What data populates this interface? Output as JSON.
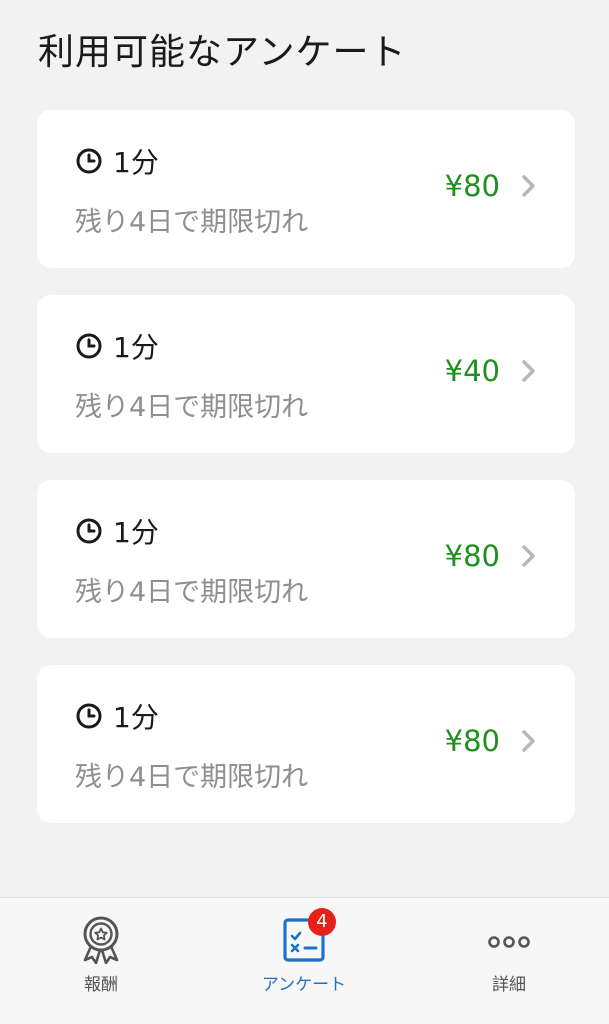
{
  "page": {
    "title": "利用可能なアンケート"
  },
  "surveys": [
    {
      "duration": "1分",
      "expiry": "残り4日で期限切れ",
      "reward": "¥80"
    },
    {
      "duration": "1分",
      "expiry": "残り4日で期限切れ",
      "reward": "¥40"
    },
    {
      "duration": "1分",
      "expiry": "残り4日で期限切れ",
      "reward": "¥80"
    },
    {
      "duration": "1分",
      "expiry": "残り4日で期限切れ",
      "reward": "¥80"
    }
  ],
  "tabbar": {
    "tabs": [
      {
        "label": "報酬",
        "icon": "award-medal-icon",
        "active": false
      },
      {
        "label": "アンケート",
        "icon": "survey-checklist-icon",
        "active": true,
        "badge": "4"
      },
      {
        "label": "詳細",
        "icon": "more-dots-icon",
        "active": false
      }
    ]
  },
  "colors": {
    "reward": "#1f8f1f",
    "active_tab": "#1a73c8",
    "badge": "#e8201a",
    "background": "#f2f2f2"
  }
}
